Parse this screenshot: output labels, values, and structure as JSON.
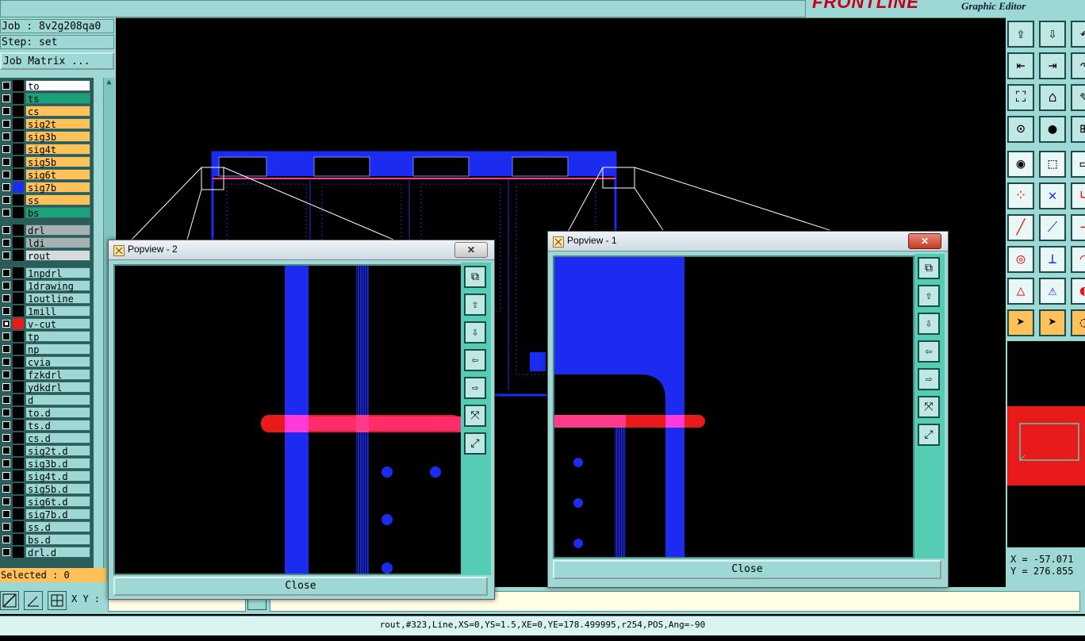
{
  "app": {
    "brand_logo": "FRONTLINE",
    "brand_subtitle": "Graphic Editor"
  },
  "job": {
    "job_line": "Job : 8v2g208qa0",
    "step_line": "Step: set",
    "matrix_button": "Job Matrix ..."
  },
  "layers": [
    {
      "name": "to",
      "color": "#ffffff",
      "swatch": "#000000",
      "checked": false
    },
    {
      "name": "ts",
      "color": "#1aa37a",
      "swatch": "#000000",
      "checked": false
    },
    {
      "name": "cs",
      "color": "#ffc25a",
      "swatch": "#000000",
      "checked": false
    },
    {
      "name": "sig2t",
      "color": "#ffc25a",
      "swatch": "#000000",
      "checked": false
    },
    {
      "name": "sig3b",
      "color": "#ffc25a",
      "swatch": "#000000",
      "checked": false
    },
    {
      "name": "sig4t",
      "color": "#ffc25a",
      "swatch": "#000000",
      "checked": false
    },
    {
      "name": "sig5b",
      "color": "#ffc25a",
      "swatch": "#000000",
      "checked": false
    },
    {
      "name": "sig6t",
      "color": "#ffc25a",
      "swatch": "#000000",
      "checked": false
    },
    {
      "name": "sig7b",
      "color": "#ffc25a",
      "swatch": "#1b2cf0",
      "checked": false
    },
    {
      "name": "ss",
      "color": "#ffc25a",
      "swatch": "#000000",
      "checked": false
    },
    {
      "name": "bs",
      "color": "#1aa37a",
      "swatch": "#000000",
      "checked": false
    },
    {
      "name": "drl",
      "color": "#a8b2b4",
      "swatch": "#000000",
      "checked": false
    },
    {
      "name": "ldi",
      "color": "#a8b2b4",
      "swatch": "#000000",
      "checked": false
    },
    {
      "name": "rout",
      "color": "#d5dcdc",
      "swatch": "#000000",
      "checked": false
    },
    {
      "name": "1npdrl",
      "color": "#9ed8d4",
      "swatch": "#000000",
      "checked": false
    },
    {
      "name": "1drawing",
      "color": "#9ed8d4",
      "swatch": "#000000",
      "checked": false
    },
    {
      "name": "1outline",
      "color": "#9ed8d4",
      "swatch": "#000000",
      "checked": false
    },
    {
      "name": "1mill",
      "color": "#9ed8d4",
      "swatch": "#000000",
      "checked": false
    },
    {
      "name": "v-cut",
      "color": "#9ed8d4",
      "swatch": "#e81a1a",
      "checked": true
    },
    {
      "name": "tp",
      "color": "#9ed8d4",
      "swatch": "#000000",
      "checked": false
    },
    {
      "name": "np",
      "color": "#9ed8d4",
      "swatch": "#000000",
      "checked": false
    },
    {
      "name": "cvia",
      "color": "#9ed8d4",
      "swatch": "#000000",
      "checked": false
    },
    {
      "name": "fzkdrl",
      "color": "#9ed8d4",
      "swatch": "#000000",
      "checked": false
    },
    {
      "name": "ydkdrl",
      "color": "#9ed8d4",
      "swatch": "#000000",
      "checked": false
    },
    {
      "name": "d",
      "color": "#9ed8d4",
      "swatch": "#000000",
      "checked": false
    },
    {
      "name": "to.d",
      "color": "#9ed8d4",
      "swatch": "#000000",
      "checked": false
    },
    {
      "name": "ts.d",
      "color": "#9ed8d4",
      "swatch": "#000000",
      "checked": false
    },
    {
      "name": "cs.d",
      "color": "#9ed8d4",
      "swatch": "#000000",
      "checked": false
    },
    {
      "name": "sig2t.d",
      "color": "#9ed8d4",
      "swatch": "#000000",
      "checked": false
    },
    {
      "name": "sig3b.d",
      "color": "#9ed8d4",
      "swatch": "#000000",
      "checked": false
    },
    {
      "name": "sig4t.d",
      "color": "#9ed8d4",
      "swatch": "#000000",
      "checked": false
    },
    {
      "name": "sig5b.d",
      "color": "#9ed8d4",
      "swatch": "#000000",
      "checked": false
    },
    {
      "name": "sig6t.d",
      "color": "#9ed8d4",
      "swatch": "#000000",
      "checked": false
    },
    {
      "name": "sig7b.d",
      "color": "#9ed8d4",
      "swatch": "#000000",
      "checked": false
    },
    {
      "name": "ss.d",
      "color": "#9ed8d4",
      "swatch": "#000000",
      "checked": false
    },
    {
      "name": "bs.d",
      "color": "#9ed8d4",
      "swatch": "#000000",
      "checked": false
    },
    {
      "name": "drl.d",
      "color": "#9ed8d4",
      "swatch": "#000000",
      "checked": false
    }
  ],
  "selected": "Selected : 0",
  "bottom": {
    "xy_label": "X Y :",
    "status": "rout,#323,Line,XS=0,YS=1.5,XE=0,YE=178.499995,r254,POS,Ang=-90"
  },
  "coords": {
    "x": "X = -57.071",
    "y": "Y = 276.855"
  },
  "popview2": {
    "title": "Popview - 2",
    "close_label": "Close",
    "close_x": "✕"
  },
  "popview1": {
    "title": "Popview - 1",
    "close_label": "Close",
    "close_x": "✕"
  },
  "colors": {
    "teal": "#9ed8d4",
    "panel_green": "#55cdb4",
    "trace_blue": "#1b2cf0",
    "vcut_red": "#e81a1a",
    "highlight_pink": "#ff3a8c"
  },
  "icons": {
    "right_toolbox": [
      "zoom-in-icon",
      "zoom-out-icon",
      "undo-view-icon",
      "pan-left-icon",
      "pan-right-icon",
      "redo-icon",
      "fit-screen-icon",
      "zoom-home-icon",
      "measure-icon",
      "snap-icon",
      "pin-icon",
      "grid-icon",
      "feature-select-icon",
      "move-icon",
      "ruler-icon",
      "connect-icon",
      "cross-icon",
      "angle-icon",
      "line-draw-icon",
      "slope-icon",
      "dimension-icon",
      "circle-icon",
      "split-icon",
      "arc-icon",
      "triangle-icon",
      "warning-icon",
      "fill-icon",
      "pointer-icon",
      "select-pointer-icon",
      "lasso-icon"
    ],
    "popup_side": [
      "zoom-window-icon",
      "pan-up-icon",
      "pan-down-icon",
      "pan-left-icon",
      "pan-right-icon",
      "zoom-fit-icon",
      "zoom-center-icon"
    ]
  }
}
